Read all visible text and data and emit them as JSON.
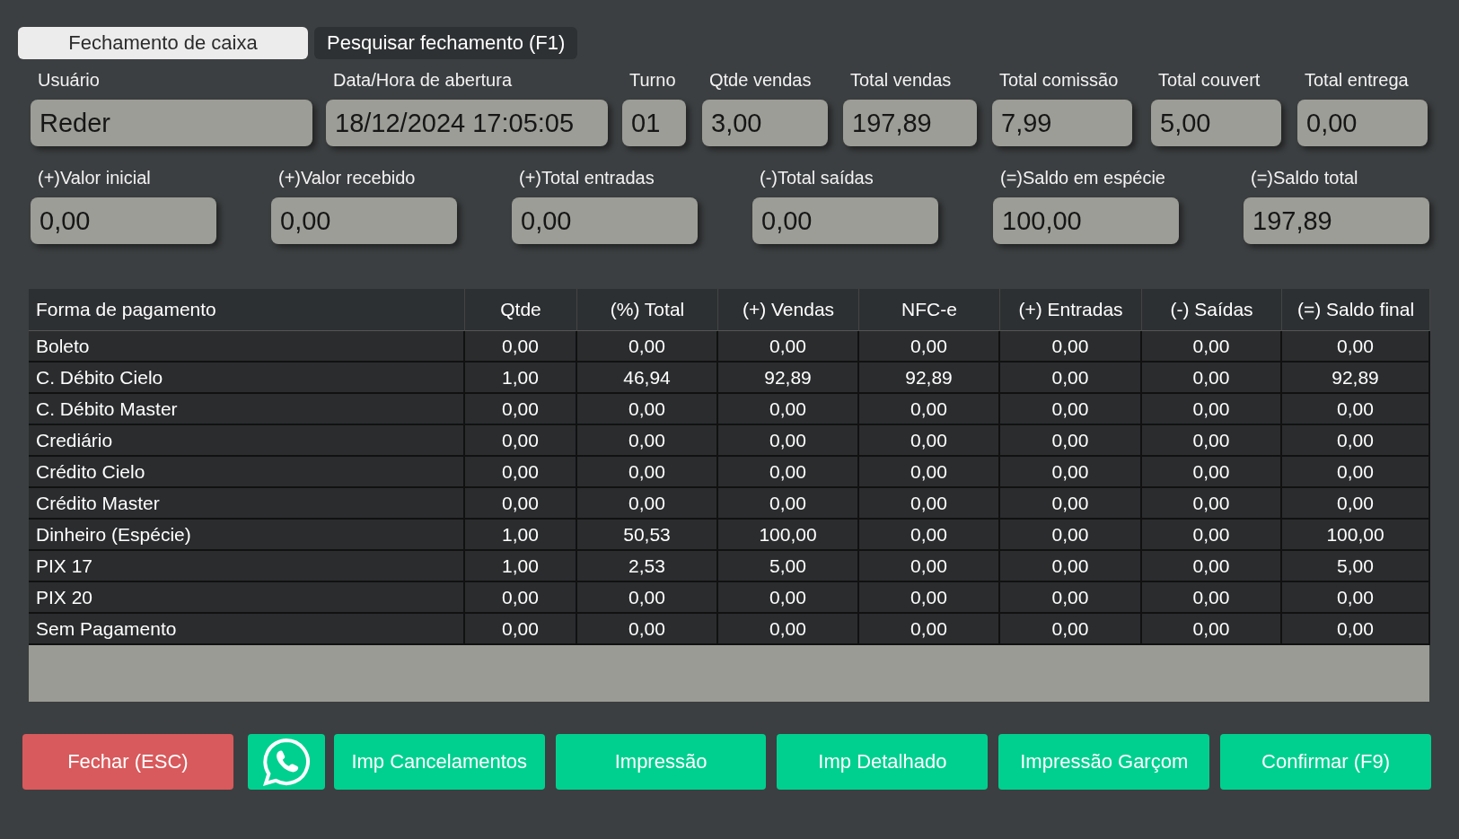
{
  "tabs": [
    {
      "label": "Fechamento de caixa",
      "selected": true
    },
    {
      "label": "Pesquisar fechamento (F1)",
      "selected": false
    }
  ],
  "fields_top": [
    {
      "label": "Usuário",
      "value": "Reder"
    },
    {
      "label": "Data/Hora de abertura",
      "value": "18/12/2024 17:05:05"
    },
    {
      "label": "Turno",
      "value": "01"
    },
    {
      "label": "Qtde vendas",
      "value": "3,00"
    },
    {
      "label": "Total vendas",
      "value": "197,89"
    },
    {
      "label": "Total comissão",
      "value": "7,99"
    },
    {
      "label": "Total couvert",
      "value": "5,00"
    },
    {
      "label": "Total entrega",
      "value": "0,00"
    }
  ],
  "fields_bottom": [
    {
      "label": "(+)Valor inicial",
      "value": "0,00"
    },
    {
      "label": "(+)Valor recebido",
      "value": "0,00"
    },
    {
      "label": "(+)Total entradas",
      "value": "0,00"
    },
    {
      "label": "(-)Total saídas",
      "value": "0,00"
    },
    {
      "label": "(=)Saldo em espécie",
      "value": "100,00"
    },
    {
      "label": "(=)Saldo total",
      "value": "197,89"
    }
  ],
  "table": {
    "columns": [
      "Forma de pagamento",
      "Qtde",
      "(%) Total",
      "(+) Vendas",
      "NFC-e",
      "(+) Entradas",
      "(-) Saídas",
      "(=) Saldo final"
    ],
    "rows": [
      [
        "Boleto",
        "0,00",
        "0,00",
        "0,00",
        "0,00",
        "0,00",
        "0,00",
        "0,00"
      ],
      [
        "C. Débito Cielo",
        "1,00",
        "46,94",
        "92,89",
        "92,89",
        "0,00",
        "0,00",
        "92,89"
      ],
      [
        "C. Débito Master",
        "0,00",
        "0,00",
        "0,00",
        "0,00",
        "0,00",
        "0,00",
        "0,00"
      ],
      [
        "Crediário",
        "0,00",
        "0,00",
        "0,00",
        "0,00",
        "0,00",
        "0,00",
        "0,00"
      ],
      [
        "Crédito Cielo",
        "0,00",
        "0,00",
        "0,00",
        "0,00",
        "0,00",
        "0,00",
        "0,00"
      ],
      [
        "Crédito Master",
        "0,00",
        "0,00",
        "0,00",
        "0,00",
        "0,00",
        "0,00",
        "0,00"
      ],
      [
        "Dinheiro (Espécie)",
        "1,00",
        "50,53",
        "100,00",
        "0,00",
        "0,00",
        "0,00",
        "100,00"
      ],
      [
        "PIX 17",
        "1,00",
        "2,53",
        "5,00",
        "0,00",
        "0,00",
        "0,00",
        "5,00"
      ],
      [
        "PIX 20",
        "0,00",
        "0,00",
        "0,00",
        "0,00",
        "0,00",
        "0,00",
        "0,00"
      ],
      [
        "Sem Pagamento",
        "0,00",
        "0,00",
        "0,00",
        "0,00",
        "0,00",
        "0,00",
        "0,00"
      ]
    ]
  },
  "buttons": [
    {
      "kind": "danger",
      "label": "Fechar (ESC)"
    },
    {
      "kind": "whatsapp"
    },
    {
      "kind": "primary",
      "label": "Imp Cancelamentos"
    },
    {
      "kind": "primary",
      "label": "Impressão"
    },
    {
      "kind": "primary",
      "label": "Imp Detalhado"
    },
    {
      "kind": "primary",
      "label": "Impressão Garçom"
    },
    {
      "kind": "primary",
      "label": "Confirmar (F9)"
    }
  ]
}
